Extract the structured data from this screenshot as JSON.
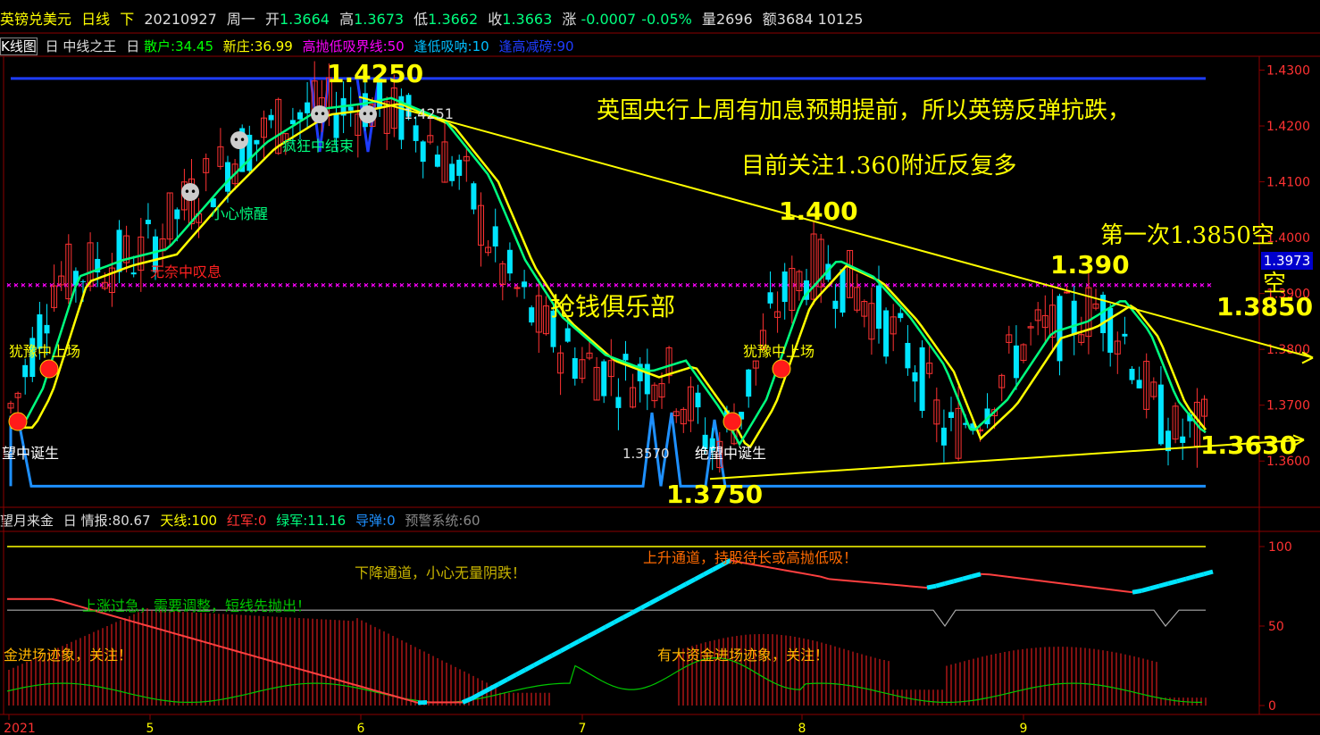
{
  "header": {
    "symbol": "英镑兑美元",
    "period": "日线",
    "dir": "下",
    "date": "20210927",
    "weekday": "周一",
    "open_label": "开",
    "open": "1.3664",
    "high_label": "高",
    "high": "1.3673",
    "low_label": "低",
    "low": "1.3662",
    "close_label": "收",
    "close": "1.3663",
    "chg_label": "涨",
    "chg": "-0.0007",
    "chg_pct": "-0.05%",
    "vol_label": "量",
    "vol": "2696",
    "amt_label": "额",
    "amt": "3684 10125"
  },
  "indicators": {
    "k": "K线图",
    "mark1": "日",
    "name": "中线之王",
    "mark2": "日",
    "retail": "散户:34.45",
    "newdealer": "新庄:36.99",
    "highsell": "高抛低吸界线:50",
    "lowbuy": "逢低吸呐:10",
    "highreduce": "逢高减磅:90"
  },
  "sub_indicators": {
    "name": "望月来金",
    "mark": "日",
    "info": "情报:80.67",
    "sky": "天线:100",
    "red": "红军:0",
    "green": "绿军:11.16",
    "missile": "导弹:0",
    "alert": "预警系统:60"
  },
  "right_axis": [
    "1.4300",
    "1.4200",
    "1.4100",
    "1.4000",
    "1.3900",
    "1.3800",
    "1.3700",
    "1.3600"
  ],
  "current_price": "1.3973",
  "sub_axis": [
    "100",
    "50",
    "0"
  ],
  "x_labels": [
    "2021",
    "5",
    "6",
    "7",
    "8",
    "9"
  ],
  "annotations": {
    "main_title": "英国央行上周有加息预期提前，所以英镑反弹抗跌，",
    "sub_title": "目前关注1.360附近反复多",
    "p_1425": "1.4250",
    "p_14251": "1.4251",
    "p_1400": "1.400",
    "p_1390": "1.390",
    "first_short": "第一次1.3850空",
    "short_char": "空",
    "p_1385": "1.3850",
    "p_1363": "1.3630",
    "p_1375": "1.3750",
    "p_13570": "1.3570",
    "grab": "抢钱俱乐部",
    "hesitate1": "犹豫中上场",
    "hesitate2": "犹豫中上场",
    "wangzhong": "望中诞生",
    "juewang": "绝望中诞生",
    "careful": "小心惊醒",
    "sigh": "无奈中叹息",
    "crazy": "疯狂中结束",
    "down_channel": "下降通道，小心无量阴跌！",
    "up_channel": "上升通道，持股待长或高抛低吸！",
    "rise_fast": "上涨过急，需要调整，短线先抛出！",
    "gold_in": "金进场迹象，关注！",
    "big_gold": "有大资金进场迹象，关注！"
  },
  "colors": {
    "up": "#ff3232",
    "down": "#00e5ff",
    "ma_fast": "#ffff00",
    "ma_slow": "#00ff7f",
    "blue_line": "#1e90ff",
    "magenta": "#ff00ff",
    "trend": "#ffff00"
  },
  "chart_data": [
    {
      "type": "candlestick",
      "title": "",
      "ylim": [
        1.353,
        1.432
      ],
      "xlabels": [
        "2021",
        "5",
        "6",
        "7",
        "8",
        "9"
      ],
      "note_levels": {
        "lowbuy": 1.3555,
        "highreduce": 1.4285,
        "magenta": 1.3915
      },
      "trendlines": [
        {
          "from": [
            0,
            1.425
          ],
          "to": [
            1,
            1.3805
          ]
        },
        {
          "from": [
            0,
            1.3575
          ],
          "to": [
            1,
            1.3645
          ]
        }
      ]
    },
    {
      "type": "line",
      "ylim": [
        0,
        100
      ],
      "levels": [
        100,
        60
      ]
    }
  ]
}
